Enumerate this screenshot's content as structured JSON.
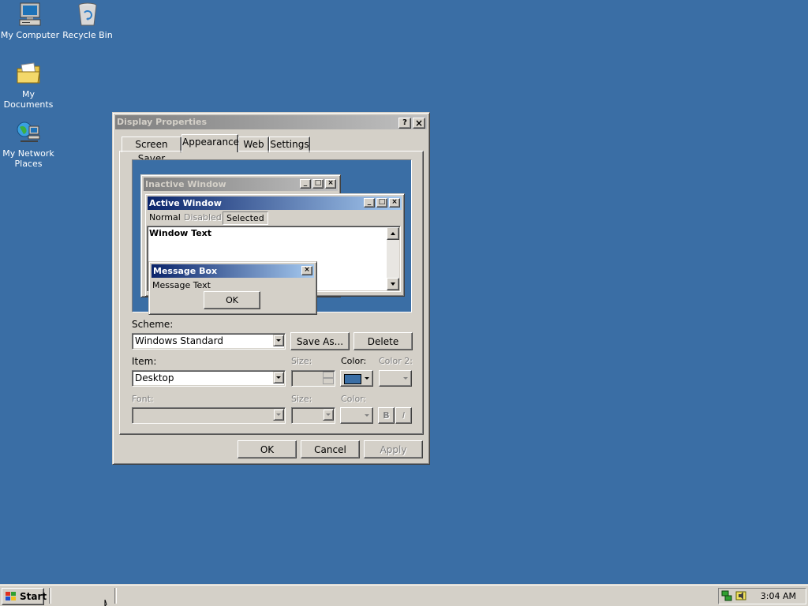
{
  "desktop": {
    "icons": [
      {
        "label": "My Computer",
        "icon": "my-computer-icon"
      },
      {
        "label": "Recycle Bin",
        "icon": "recycle-bin-icon"
      },
      {
        "label": "My Documents",
        "icon": "folder-icon"
      },
      {
        "label": "My Network Places",
        "icon": "network-icon"
      }
    ],
    "background": "#3a6ea5"
  },
  "dialog": {
    "title": "Display Properties",
    "help_glyph": "?",
    "close_glyph": "×",
    "tabs": [
      {
        "label": "Screen Saver",
        "active": false
      },
      {
        "label": "Appearance",
        "active": true
      },
      {
        "label": "Web",
        "active": false
      },
      {
        "label": "Settings",
        "active": false
      }
    ],
    "preview": {
      "inactive_title": "Inactive Window",
      "active_title": "Active Window",
      "menu": {
        "normal": "Normal",
        "disabled": "Disabled",
        "selected": "Selected"
      },
      "window_text": "Window Text",
      "message_box_title": "Message Box",
      "message_text": "Message Text",
      "ok_label": "OK"
    },
    "scheme": {
      "label": "Scheme:",
      "value": "Windows Standard",
      "save_as": "Save As...",
      "delete": "Delete"
    },
    "item": {
      "label": "Item:",
      "value": "Desktop",
      "size_label": "Size:",
      "color_label": "Color:",
      "color2_label": "Color 2:",
      "color_value": "#3a6ea5"
    },
    "font": {
      "label": "Font:",
      "size_label": "Size:",
      "color_label": "Color:",
      "bold_label": "B",
      "italic_label": "I"
    },
    "buttons": {
      "ok": "OK",
      "cancel": "Cancel",
      "apply": "Apply"
    }
  },
  "taskbar": {
    "start_label": "Start",
    "clock": "3:04 AM"
  }
}
